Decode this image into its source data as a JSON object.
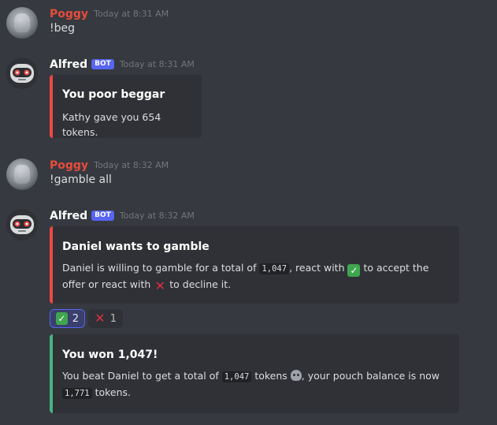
{
  "messages": [
    {
      "author": "Poggy",
      "time": "Today at 8:31 AM",
      "text": "!beg"
    },
    {
      "author": "Alfred",
      "bot_tag": "BOT",
      "time": "Today at 8:31 AM",
      "embed": {
        "title": "You poor beggar",
        "description": "Kathy gave you 654 tokens."
      }
    },
    {
      "author": "Poggy",
      "time": "Today at 8:32 AM",
      "text": "!gamble all"
    },
    {
      "author": "Alfred",
      "bot_tag": "BOT",
      "time": "Today at 8:32 AM",
      "embed": {
        "title": "Daniel wants to gamble",
        "desc_part1": "Daniel is willing to gamble for a total of ",
        "amount": "1,047",
        "desc_part2": ", react with ",
        "desc_part3": " to accept the offer or react with ",
        "desc_part4": " to decline it."
      },
      "reactions": [
        {
          "emoji": "check-mark",
          "count": "2",
          "active": true
        },
        {
          "emoji": "cross-mark",
          "count": "1",
          "active": false
        }
      ],
      "embed2": {
        "title": "You won 1,047!",
        "desc_part1": "You beat Daniel to get a total of ",
        "amount": "1,047",
        "desc_part2": " tokens ",
        "desc_part3": ", your pouch balance is now ",
        "balance": "1,771",
        "desc_part4": " tokens."
      }
    }
  ],
  "colors": {
    "background": "#36393f",
    "embed_bg": "#2f3136",
    "red_accent": "#f04747",
    "green_accent": "#43b581",
    "poggy_name": "#e74c3c",
    "bot_tag": "#5865f2"
  }
}
